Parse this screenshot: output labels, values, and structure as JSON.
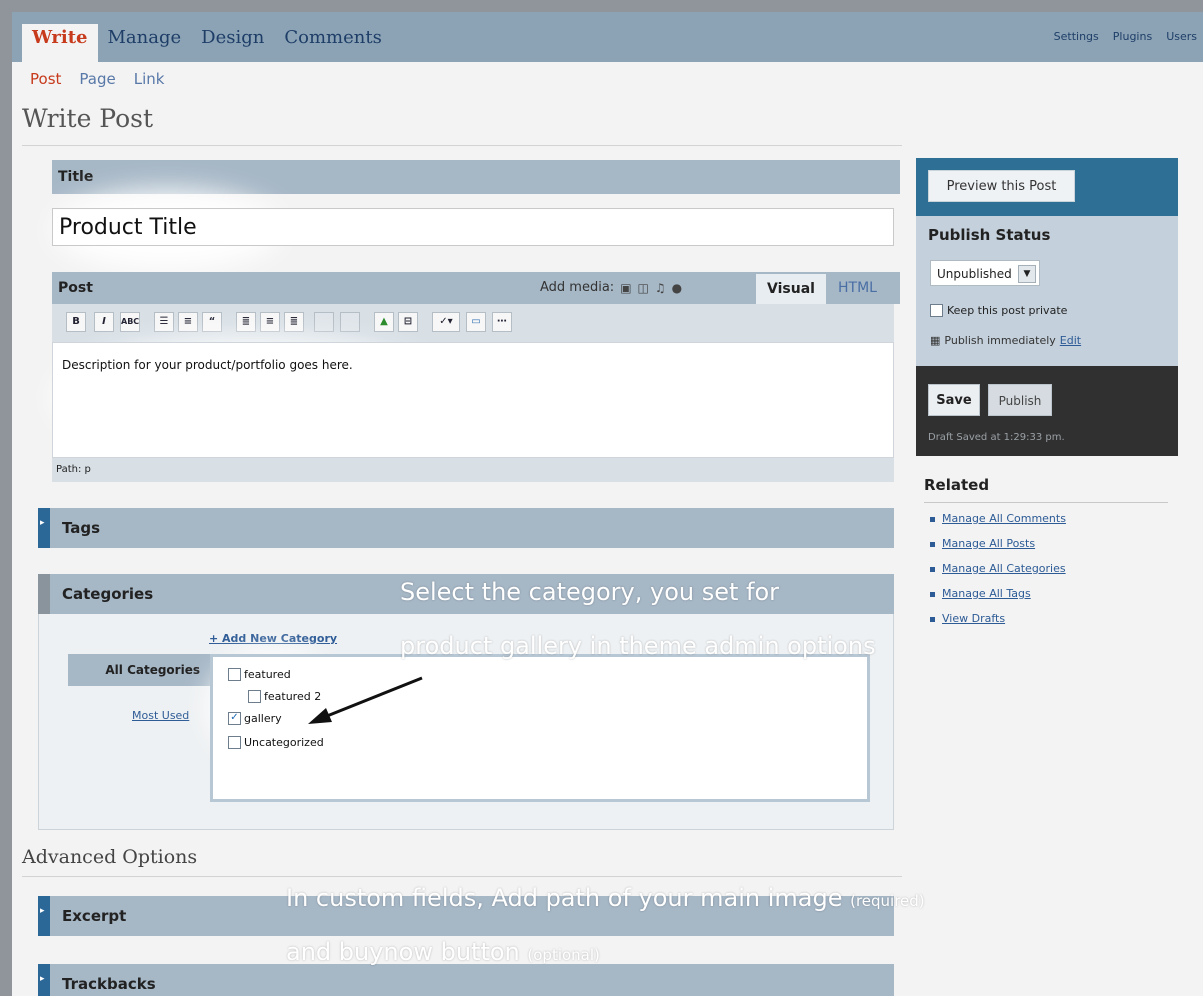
{
  "nav": {
    "main_tabs": [
      "Write",
      "Manage",
      "Design",
      "Comments"
    ],
    "user_links": [
      "Settings",
      "Plugins",
      "Users"
    ],
    "sub_tabs": [
      "Post",
      "Page",
      "Link"
    ]
  },
  "page": {
    "title": "Write Post"
  },
  "title_box": {
    "label": "Title",
    "value": "Product Title"
  },
  "post_box": {
    "label": "Post",
    "add_media_label": "Add media:",
    "visual_tab": "Visual",
    "html_tab": "HTML",
    "content": "Description for your product/portfolio goes here.",
    "path": "Path: p"
  },
  "tags_box": {
    "label": "Tags"
  },
  "categories_box": {
    "label": "Categories",
    "add_new": "+ Add New Category",
    "all_tab": "All Categories",
    "most_used_tab": "Most Used",
    "items": [
      {
        "label": "featured",
        "checked": false
      },
      {
        "label": "featured 2",
        "checked": false
      },
      {
        "label": "gallery",
        "checked": true
      },
      {
        "label": "Uncategorized",
        "checked": false
      }
    ]
  },
  "annotations": {
    "category_line1": "Select the category, you set for",
    "category_line2": "product gallery in theme admin options",
    "custom_line1": "In custom fields, Add path of your main image",
    "custom_line1_small": "(required)",
    "custom_line2": "and buynow button",
    "custom_line2_small": "(optional)"
  },
  "advanced": {
    "title": "Advanced Options",
    "excerpt_label": "Excerpt",
    "trackbacks_label": "Trackbacks"
  },
  "sidebar": {
    "preview_button": "Preview this Post",
    "publish_status_title": "Publish Status",
    "status_value": "Unpublished",
    "keep_private_label": "Keep this post private",
    "publish_immediately": "Publish immediately",
    "edit_link": "Edit",
    "save_button": "Save",
    "publish_button": "Publish",
    "draft_saved": "Draft Saved at 1:29:33 pm.",
    "related_title": "Related",
    "related_links": [
      "Manage All Comments",
      "Manage All Posts",
      "Manage All Categories",
      "Manage All Tags",
      "View Drafts"
    ]
  },
  "colors": {
    "topnav_bg": "#8ca3b5",
    "header_bar": "#a6b7c6",
    "accent_red": "#c73a1c",
    "link_blue": "#2d5b96",
    "sidebar_blue": "#2e6f96"
  }
}
